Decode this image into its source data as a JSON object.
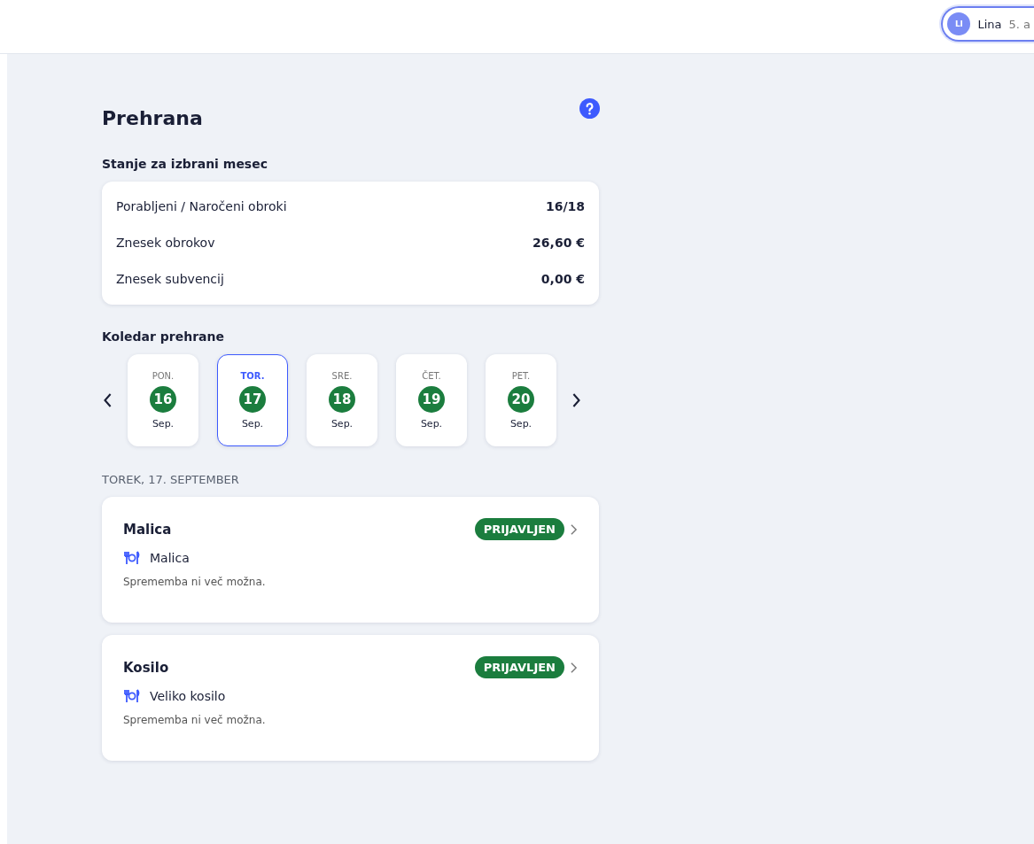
{
  "user": {
    "initials": "LI",
    "name": "Lina",
    "class": "5. a"
  },
  "page": {
    "title": "Prehrana"
  },
  "summary": {
    "heading": "Stanje za izbrani mesec",
    "rows": [
      {
        "label": "Porabljeni / Naročeni obroki",
        "value": "16/18"
      },
      {
        "label": "Znesek obrokov",
        "value": "26,60 €"
      },
      {
        "label": "Znesek subvencij",
        "value": "0,00 €"
      }
    ]
  },
  "calendar": {
    "heading": "Koledar prehrane",
    "days": [
      {
        "weekday": "PON.",
        "day": "16",
        "month": "Sep.",
        "selected": false
      },
      {
        "weekday": "TOR.",
        "day": "17",
        "month": "Sep.",
        "selected": true
      },
      {
        "weekday": "SRE.",
        "day": "18",
        "month": "Sep.",
        "selected": false
      },
      {
        "weekday": "ČET.",
        "day": "19",
        "month": "Sep.",
        "selected": false
      },
      {
        "weekday": "PET.",
        "day": "20",
        "month": "Sep.",
        "selected": false
      }
    ]
  },
  "selected_date": "TOREK, 17. SEPTEMBER",
  "meals": [
    {
      "title": "Malica",
      "status": "PRIJAVLJEN",
      "menu": "Malica",
      "note": "Sprememba ni več možna."
    },
    {
      "title": "Kosilo",
      "status": "PRIJAVLJEN",
      "menu": "Veliko kosilo",
      "note": "Sprememba ni več možna."
    }
  ]
}
